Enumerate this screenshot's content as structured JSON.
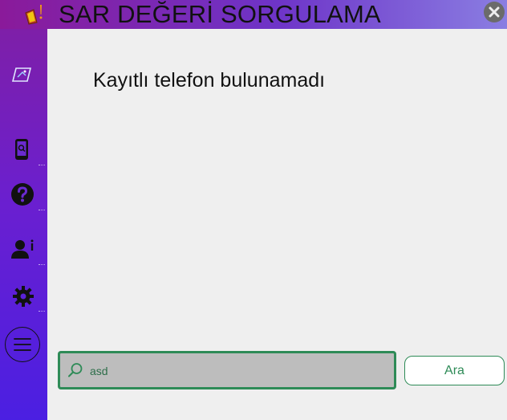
{
  "window": {
    "title": "SAR DEĞERİ SORGULAMA"
  },
  "colors": {
    "accent": "#2e8b57",
    "sidebar_top": "#7e1fa8",
    "sidebar_bottom": "#4b1fe2",
    "titlebar": "#6e34c8"
  },
  "sidebar": {
    "items": [
      {
        "name": "logo",
        "icon": "ticket-icon"
      },
      {
        "name": "phone-search",
        "icon": "phone-search-icon"
      },
      {
        "name": "help",
        "icon": "question-circle-icon"
      },
      {
        "name": "user-info",
        "icon": "user-info-icon"
      },
      {
        "name": "settings",
        "icon": "gear-icon"
      },
      {
        "name": "menu",
        "icon": "hamburger-menu-icon"
      }
    ]
  },
  "main": {
    "message": "Kayıtlı telefon bulunamadı"
  },
  "search": {
    "value": "asd",
    "button_label": "Ara"
  }
}
